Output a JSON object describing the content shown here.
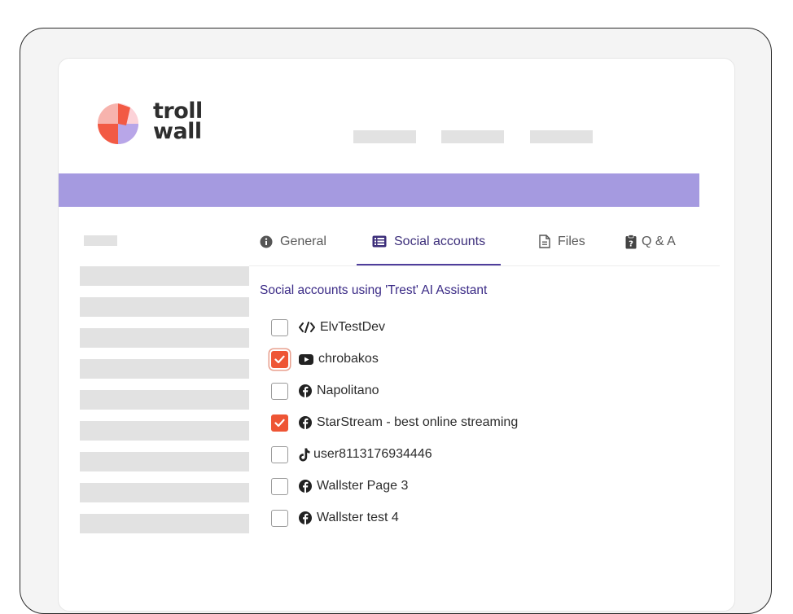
{
  "brand": {
    "line1": "troll",
    "line2": "wall"
  },
  "tabs": [
    {
      "label": "General",
      "icon": "info-circle-icon",
      "active": false
    },
    {
      "label": "Social accounts",
      "icon": "list-icon",
      "active": true
    },
    {
      "label": "Files",
      "icon": "file-icon",
      "active": false
    },
    {
      "label": "Q & A",
      "icon": "clipboard-question-icon",
      "active": false
    }
  ],
  "section": {
    "title": "Social accounts using 'Trest' AI Assistant"
  },
  "accounts": [
    {
      "name": "ElvTestDev",
      "platform_icon": "code-icon",
      "checked": false
    },
    {
      "name": "chrobakos",
      "platform_icon": "youtube-icon",
      "checked": true
    },
    {
      "name": "Napolitano",
      "platform_icon": "facebook-icon",
      "checked": false
    },
    {
      "name": "StarStream - best online streaming",
      "platform_icon": "facebook-icon",
      "checked": true
    },
    {
      "name": "user8113176934446",
      "platform_icon": "tiktok-icon",
      "checked": false
    },
    {
      "name": "Wallster Page 3",
      "platform_icon": "facebook-icon",
      "checked": false
    },
    {
      "name": "Wallster test 4",
      "platform_icon": "facebook-icon",
      "checked": false
    }
  ],
  "colors": {
    "accent": "#a59ae0",
    "checkbox_checked": "#ee5535",
    "active_tab": "#3c2e7a",
    "placeholder": "#e2e2e2"
  }
}
